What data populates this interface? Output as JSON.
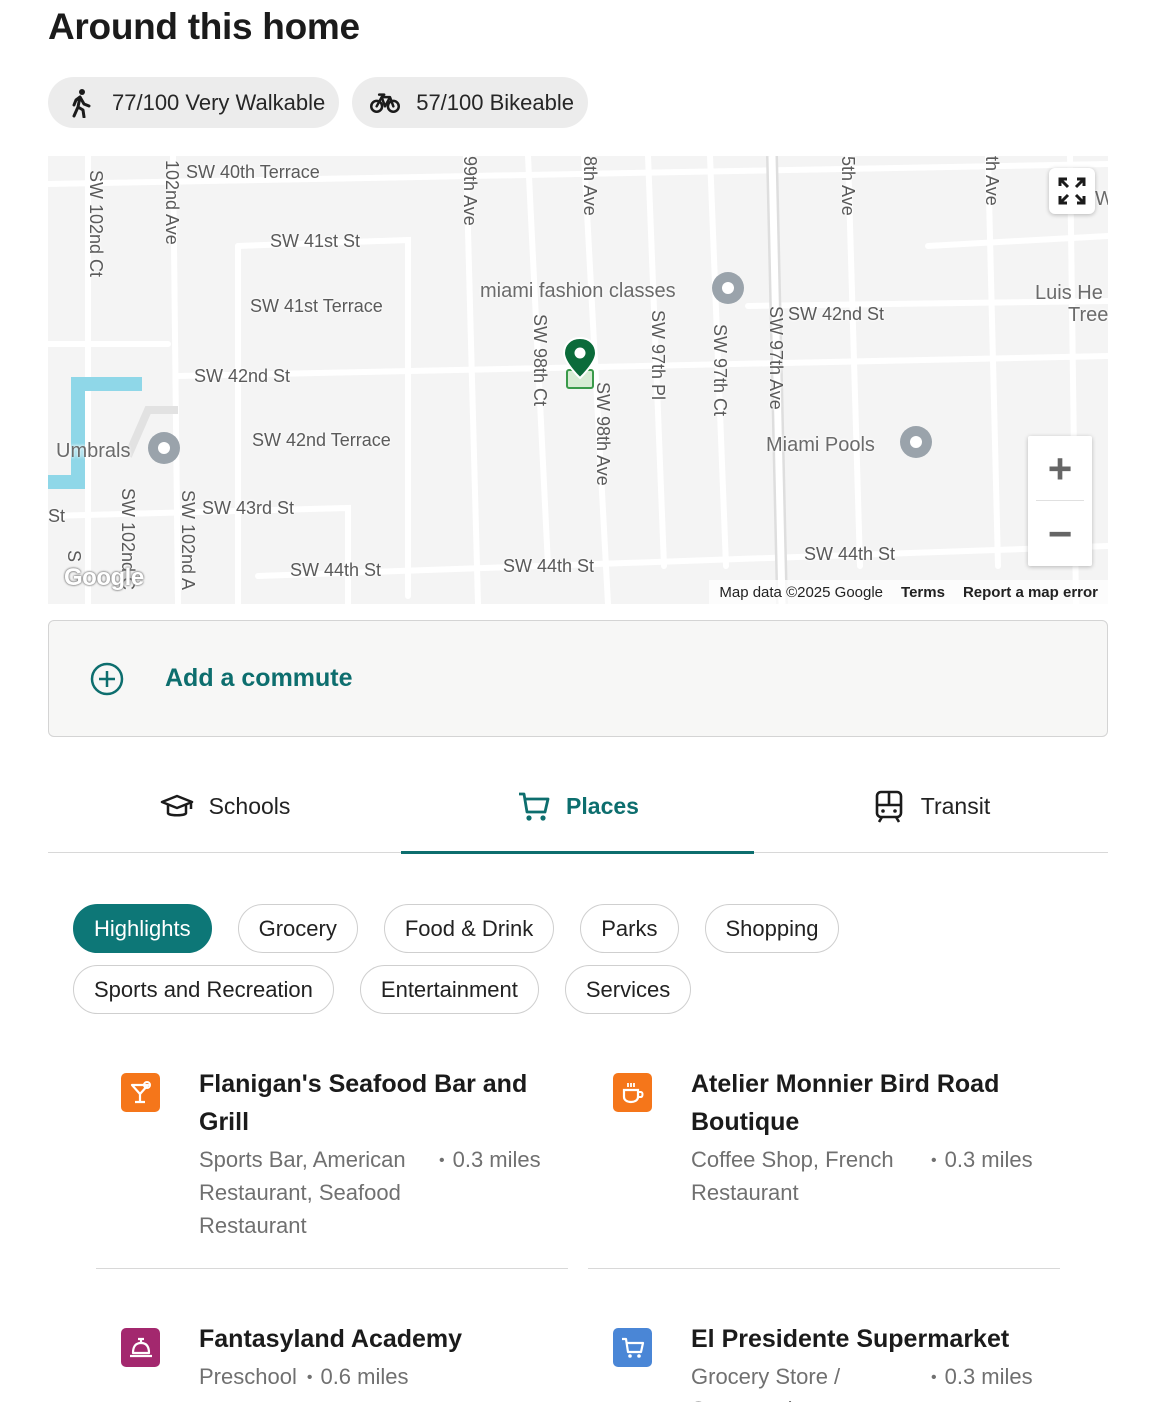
{
  "section_title": "Around this home",
  "scores": [
    {
      "icon": "walk-icon",
      "label": "77/100 Very Walkable"
    },
    {
      "icon": "bike-icon",
      "label": "57/100 Bikeable"
    }
  ],
  "map": {
    "streets": {
      "sw_40th_terrace": "SW 40th Terrace",
      "sw_41st_st": "SW 41st St",
      "sw_41st_terrace": "SW 41st Terrace",
      "sw_42nd_st_left": "SW 42nd St",
      "sw_42nd_st_right": "SW 42nd St",
      "sw_42nd_terrace": "SW 42nd Terrace",
      "sw_43rd_st": "SW 43rd St",
      "sw_44th_st_left": "SW 44th St",
      "sw_44th_st_mid": "SW 44th St",
      "sw_44th_st_right": "SW 44th St",
      "sw_102nd_ct_top": "SW 102nd Ct",
      "ave_102nd_top": "102nd Ave",
      "ave_99th_top": "99th Ave",
      "ave_98th_top": "8th Ave",
      "ave_95th_top": "5th Ave",
      "ave_94th_top": "th Ave",
      "sw_98th_ct": "SW 98th Ct",
      "sw_98th_ave": "SW 98th Ave",
      "sw_97th_pl": "SW 97th Pl",
      "sw_97th_ct": "SW 97th Ct",
      "sw_97th_ave": "SW 97th Ave",
      "sw_102nd_ct_bottom": "SW 102nd C",
      "sw_102nd_ave_bottom": "SW 102nd A",
      "st_fragment": "St",
      "sw_fragment": "S"
    },
    "pois": {
      "miami_fashion": "miami fashion classes",
      "umbrals": "Umbrals",
      "miami_pools": "Miami Pools",
      "luis_he": "Luis He",
      "tree": "Tree",
      "w_fragment": "W"
    },
    "google": "Google",
    "attribution": "Map data ©2025 Google",
    "terms": "Terms",
    "report": "Report a map error",
    "zoom_in": "+",
    "zoom_out": "−"
  },
  "commute": {
    "label": "Add a commute"
  },
  "tabs": [
    {
      "icon": "graduation-cap-icon",
      "label": "Schools",
      "active": false
    },
    {
      "icon": "cart-icon",
      "label": "Places",
      "active": true
    },
    {
      "icon": "train-icon",
      "label": "Transit",
      "active": false
    }
  ],
  "filters": {
    "row1": [
      "Highlights",
      "Grocery",
      "Food & Drink",
      "Parks",
      "Shopping"
    ],
    "row2": [
      "Sports and Recreation",
      "Entertainment",
      "Services"
    ],
    "active": "Highlights"
  },
  "places": [
    {
      "name": "Flanigan's Seafood Bar and Grill",
      "category": "Sports Bar, American Restaurant, Seafood Restaurant",
      "distance": "0.3 miles",
      "icon": "cocktail-icon",
      "color": "#f5761a"
    },
    {
      "name": "Atelier Monnier Bird Road Boutique",
      "category": "Coffee Shop, French Restaurant",
      "distance": "0.3 miles",
      "icon": "coffee-icon",
      "color": "#f5761a"
    },
    {
      "name": "Fantasyland Academy",
      "category": "Preschool",
      "distance": "0.6 miles",
      "icon": "service-bell-icon",
      "color": "#a3286e"
    },
    {
      "name": "El Presidente Supermarket",
      "category": "Grocery Store / Supermarket",
      "distance": "0.3 miles",
      "icon": "cart-icon",
      "color": "#4a86d6"
    }
  ],
  "colors": {
    "accent": "#0d6e6e",
    "chip_active": "#0d7777",
    "pin": "#0b6b3a"
  }
}
